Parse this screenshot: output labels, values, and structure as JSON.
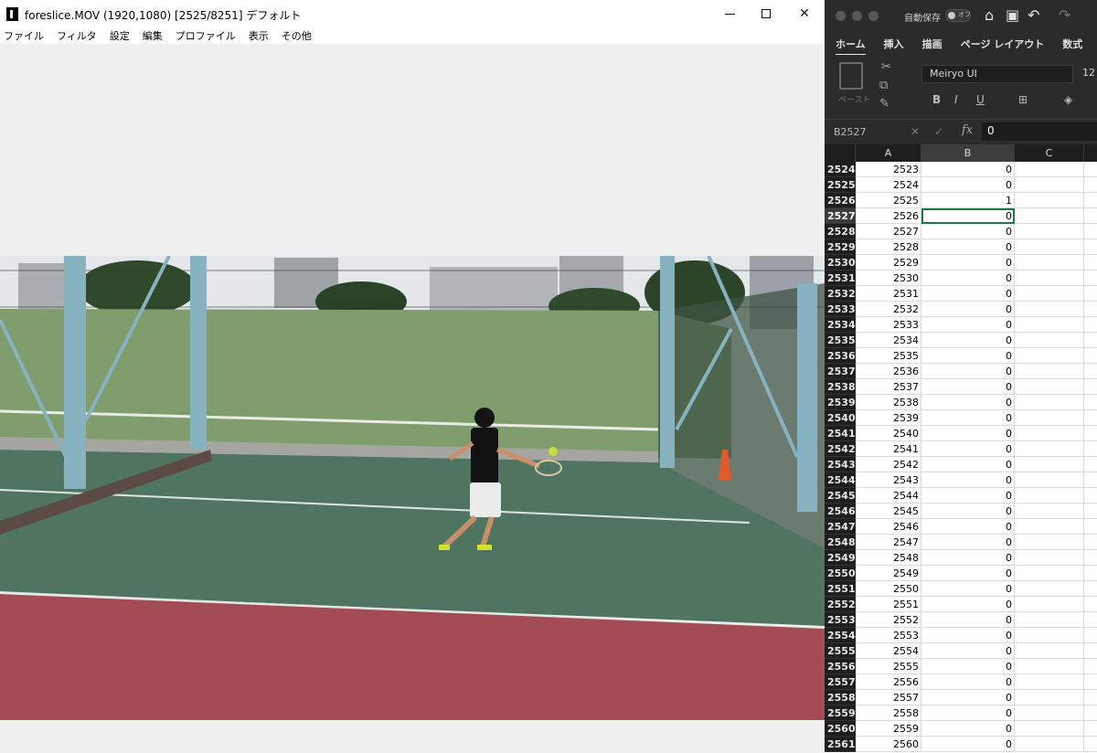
{
  "video_window": {
    "title": "foreslice.MOV (1920,1080)  [2525/8251]  デフォルト",
    "buttons": {
      "minimize": "",
      "maximize": "",
      "close": "✕"
    },
    "menu": [
      "ファイル",
      "フィルタ",
      "設定",
      "編集",
      "プロファイル",
      "表示",
      "その他"
    ]
  },
  "excel": {
    "autosave_label": "自動保存",
    "autosave_state": "オフ",
    "ribbon_tabs": [
      "ホーム",
      "挿入",
      "描画",
      "ページ レイアウト",
      "数式"
    ],
    "active_tab": "ホーム",
    "paste_label": "ペースト",
    "font_name": "Meiryo UI",
    "font_size": "12",
    "format_buttons": [
      "B",
      "I",
      "U"
    ],
    "name_box": "B2527",
    "formula_value": "0",
    "columns": [
      "A",
      "B",
      "C"
    ],
    "selected_row": "2527",
    "rows": [
      {
        "n": "2524",
        "a": "2523",
        "b": "0"
      },
      {
        "n": "2525",
        "a": "2524",
        "b": "0"
      },
      {
        "n": "2526",
        "a": "2525",
        "b": "1"
      },
      {
        "n": "2527",
        "a": "2526",
        "b": "0"
      },
      {
        "n": "2528",
        "a": "2527",
        "b": "0"
      },
      {
        "n": "2529",
        "a": "2528",
        "b": "0"
      },
      {
        "n": "2530",
        "a": "2529",
        "b": "0"
      },
      {
        "n": "2531",
        "a": "2530",
        "b": "0"
      },
      {
        "n": "2532",
        "a": "2531",
        "b": "0"
      },
      {
        "n": "2533",
        "a": "2532",
        "b": "0"
      },
      {
        "n": "2534",
        "a": "2533",
        "b": "0"
      },
      {
        "n": "2535",
        "a": "2534",
        "b": "0"
      },
      {
        "n": "2536",
        "a": "2535",
        "b": "0"
      },
      {
        "n": "2537",
        "a": "2536",
        "b": "0"
      },
      {
        "n": "2538",
        "a": "2537",
        "b": "0"
      },
      {
        "n": "2539",
        "a": "2538",
        "b": "0"
      },
      {
        "n": "2540",
        "a": "2539",
        "b": "0"
      },
      {
        "n": "2541",
        "a": "2540",
        "b": "0"
      },
      {
        "n": "2542",
        "a": "2541",
        "b": "0"
      },
      {
        "n": "2543",
        "a": "2542",
        "b": "0"
      },
      {
        "n": "2544",
        "a": "2543",
        "b": "0"
      },
      {
        "n": "2545",
        "a": "2544",
        "b": "0"
      },
      {
        "n": "2546",
        "a": "2545",
        "b": "0"
      },
      {
        "n": "2547",
        "a": "2546",
        "b": "0"
      },
      {
        "n": "2548",
        "a": "2547",
        "b": "0"
      },
      {
        "n": "2549",
        "a": "2548",
        "b": "0"
      },
      {
        "n": "2550",
        "a": "2549",
        "b": "0"
      },
      {
        "n": "2551",
        "a": "2550",
        "b": "0"
      },
      {
        "n": "2552",
        "a": "2551",
        "b": "0"
      },
      {
        "n": "2553",
        "a": "2552",
        "b": "0"
      },
      {
        "n": "2554",
        "a": "2553",
        "b": "0"
      },
      {
        "n": "2555",
        "a": "2554",
        "b": "0"
      },
      {
        "n": "2556",
        "a": "2555",
        "b": "0"
      },
      {
        "n": "2557",
        "a": "2556",
        "b": "0"
      },
      {
        "n": "2558",
        "a": "2557",
        "b": "0"
      },
      {
        "n": "2559",
        "a": "2558",
        "b": "0"
      },
      {
        "n": "2560",
        "a": "2559",
        "b": "0"
      },
      {
        "n": "2561",
        "a": "2560",
        "b": "0"
      }
    ]
  }
}
